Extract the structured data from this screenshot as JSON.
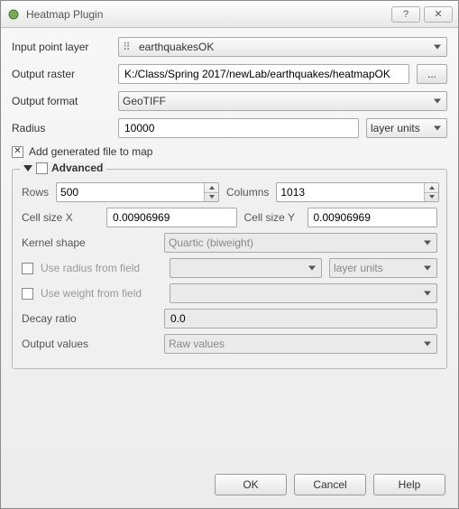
{
  "window": {
    "title": "Heatmap Plugin"
  },
  "labels": {
    "input_layer": "Input point layer",
    "output_raster": "Output raster",
    "output_format": "Output format",
    "radius": "Radius",
    "add_to_map": "Add generated file to map",
    "advanced": "Advanced",
    "rows": "Rows",
    "columns": "Columns",
    "cellx": "Cell size X",
    "celly": "Cell size Y",
    "kernel": "Kernel shape",
    "use_radius_field": "Use radius from field",
    "use_weight_field": "Use weight from field",
    "decay": "Decay ratio",
    "output_values": "Output values",
    "browse": "...",
    "ok": "OK",
    "cancel": "Cancel",
    "help": "Help"
  },
  "values": {
    "input_layer": "earthquakesOK",
    "output_raster": "K:/Class/Spring 2017/newLab/earthquakes/heatmapOK",
    "output_format": "GeoTIFF",
    "radius": "10000",
    "radius_units": "layer units",
    "add_to_map_checked": true,
    "advanced_checked": false,
    "rows": "500",
    "columns": "1013",
    "cellx": "0.00906969",
    "celly": "0.00906969",
    "kernel": "Quartic (biweight)",
    "radius_field_units": "layer units",
    "decay": "0.0",
    "output_values": "Raw values"
  }
}
